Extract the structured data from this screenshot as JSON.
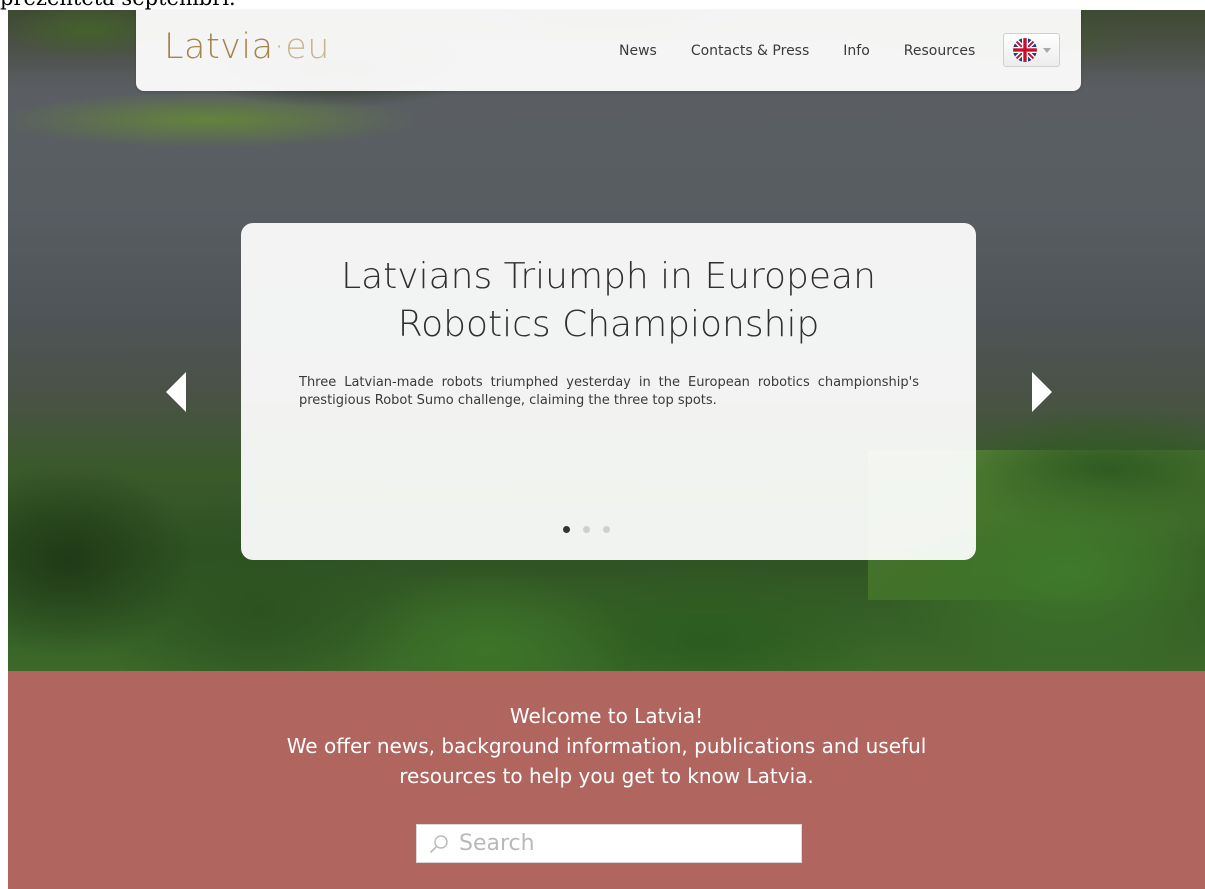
{
  "top_cut_text": "prezentēta septembrī.",
  "navbar": {
    "logo": {
      "name": "Latvia",
      "separator": "·",
      "tld": "eu"
    },
    "links": [
      "News",
      "Contacts & Press",
      "Info",
      "Resources"
    ],
    "language": {
      "icon": "uk-flag-icon",
      "caret": "chevron-down-icon"
    }
  },
  "slider": {
    "title_line1": "Latvians Triumph in European",
    "title_line2": "Robotics Championship",
    "body": "Three Latvian-made robots triumphed yesterday in the European robotics championship's prestigious Robot Sumo challenge, claiming the three top spots.",
    "dots_count": 3,
    "active_dot": 0,
    "prev_icon": "chevron-left-icon",
    "next_icon": "chevron-right-icon"
  },
  "welcome": {
    "line1": "Welcome to Latvia!",
    "line2": "We offer news, background information, publications and useful",
    "line3": "resources to help you get to know Latvia."
  },
  "search": {
    "placeholder": "Search",
    "value": "",
    "icon": "search-icon"
  },
  "colors": {
    "logo_gold": "#a6844c",
    "welcome_bg": "#b0655f",
    "text_dark": "#2f2f2f"
  }
}
